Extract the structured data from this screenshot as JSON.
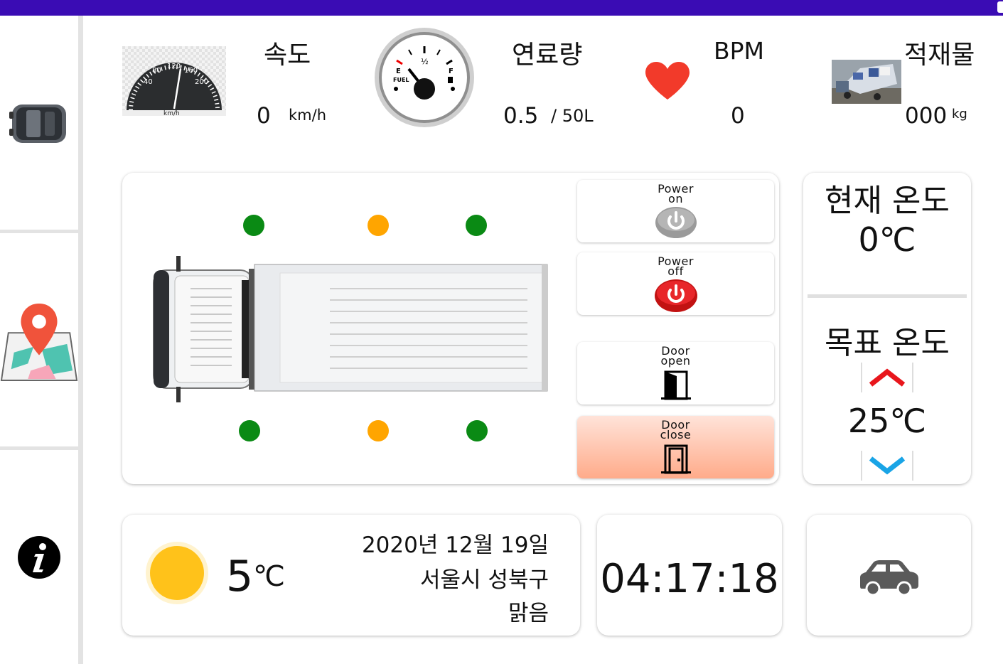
{
  "top_stats": {
    "speed": {
      "label": "속도",
      "value": "0",
      "unit": "km/h"
    },
    "fuel": {
      "label": "연료량",
      "value": "0.5",
      "capacity": "/ 50L"
    },
    "bpm": {
      "label": "BPM",
      "value": "0"
    },
    "cargo": {
      "label": "적재물",
      "value": "000",
      "unit": "kg"
    }
  },
  "speedometer": {
    "ticks": [
      "40",
      "80",
      "120",
      "160",
      "200"
    ],
    "unit": "km/h"
  },
  "fuel_gauge": {
    "empty": "E",
    "half": "½",
    "full": "F",
    "label": "FUEL"
  },
  "controls": {
    "power_on": {
      "line1": "Power",
      "line2": "on"
    },
    "power_off": {
      "line1": "Power",
      "line2": "off"
    },
    "door_open": {
      "line1": "Door",
      "line2": "open"
    },
    "door_close": {
      "line1": "Door",
      "line2": "close",
      "active": true
    }
  },
  "temperature": {
    "current_label": "현재 온도",
    "current_value": "0℃",
    "target_label": "목표 온도",
    "target_value": "25℃"
  },
  "weather": {
    "temp_value": "5",
    "temp_unit": "℃",
    "date": "2020년 12월 19일",
    "location": "서울시 성북구",
    "condition": "맑음"
  },
  "clock": {
    "time": "04:17:18"
  },
  "sensor_colors": {
    "ok": "#0a8a14",
    "warn": "#ffa500"
  },
  "accent": {
    "topbar": "#3a0cb4",
    "heart": "#f23a2a",
    "arrow_up": "#e8161c",
    "arrow_down": "#19a4e6"
  }
}
